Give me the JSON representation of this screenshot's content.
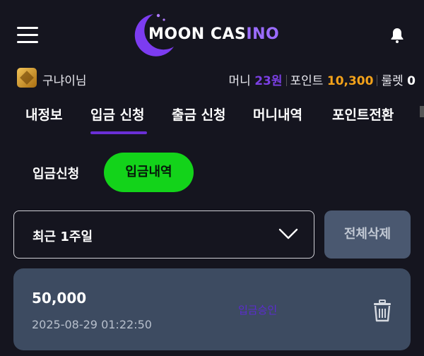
{
  "header": {
    "logo_text_main": "MOON CAS",
    "logo_text_accent": "INO",
    "icons": {
      "menu": "hamburger-menu-icon",
      "notifications": "bell-icon"
    }
  },
  "user": {
    "name": "구냐이님",
    "money_label": "머니",
    "money_value": "23원",
    "point_label": "포인트",
    "point_value": "10,300",
    "roulette_label": "룰렛",
    "roulette_value": "0"
  },
  "tabs": [
    {
      "label": "내정보",
      "active": false
    },
    {
      "label": "입금 신청",
      "active": true
    },
    {
      "label": "출금 신청",
      "active": false
    },
    {
      "label": "머니내역",
      "active": false
    },
    {
      "label": "포인트전환",
      "active": false
    }
  ],
  "subtabs": {
    "request": "입금신청",
    "history": "입금내역"
  },
  "filter": {
    "selected": "최근 1주일",
    "delete_all": "전체삭제"
  },
  "records": [
    {
      "amount": "50,000",
      "datetime": "2025-08-29 01:22:50",
      "status": "입금승인"
    }
  ],
  "colors": {
    "background": "#15151f",
    "accent_purple": "#6a2fd6",
    "accent_green": "#13d31a",
    "point_orange": "#f3a21a",
    "card": "#3d4b61"
  }
}
